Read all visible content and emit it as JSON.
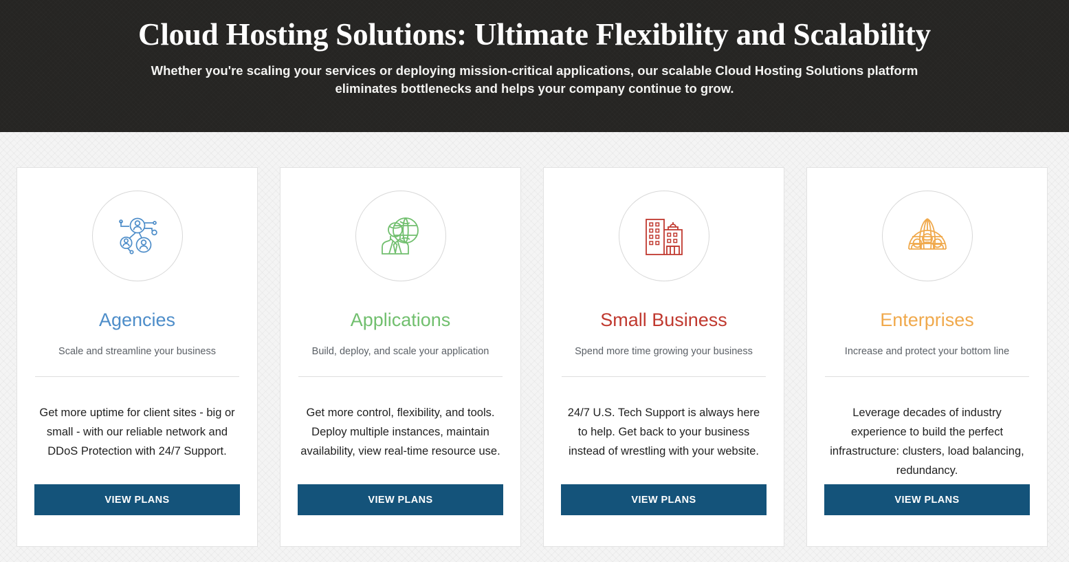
{
  "hero": {
    "title": "Cloud Hosting Solutions: Ultimate Flexibility and Scalability",
    "subtitle": "Whether you're scaling your services or deploying mission-critical applications, our scalable Cloud Hosting Solutions platform eliminates bottlenecks and helps your company continue to grow.",
    "background_color": "#262523",
    "text_color": "#ffffff"
  },
  "theme": {
    "page_background": "#f4f4f4",
    "card_background": "#ffffff",
    "card_border": "#e2e2e2",
    "divider_color": "#dedede",
    "body_text_color": "#1f1f1f",
    "subtitle_text_color": "#5b6066",
    "cta_background": "#14537a",
    "cta_text_color": "#ffffff"
  },
  "cards": [
    {
      "icon": "network-people-icon",
      "accent_color": "#4d8dc9",
      "title": "Agencies",
      "subtitle": "Scale and streamline your business",
      "body": "Get more uptime for client sites - big or small - with our reliable network and DDoS Protection with 24/7 Support.",
      "cta_label": "VIEW PLANS"
    },
    {
      "icon": "person-globe-icon",
      "accent_color": "#71bf6e",
      "title": "Applications",
      "subtitle": "Build, deploy, and scale your application",
      "body": "Get more control, flexibility, and tools. Deploy multiple instances, maintain availability, view real-time resource use.",
      "cta_label": "VIEW PLANS"
    },
    {
      "icon": "office-buildings-icon",
      "accent_color": "#c0392f",
      "title": "Small Business",
      "subtitle": "Spend more time growing your business",
      "body": "24/7 U.S. Tech Support is always here to help. Get back to your business instead of wrestling with your website.",
      "cta_label": "VIEW PLANS"
    },
    {
      "icon": "globe-team-icon",
      "accent_color": "#f0a94c",
      "title": "Enterprises",
      "subtitle": "Increase and protect your bottom line",
      "body": "Leverage decades of industry experience to build the perfect infrastructure: clusters, load balancing, redundancy.",
      "cta_label": "VIEW PLANS"
    }
  ]
}
